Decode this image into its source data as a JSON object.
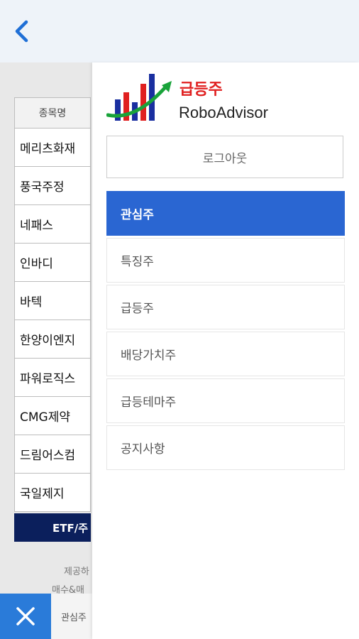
{
  "header": {
    "back_icon": "chevron-left-icon"
  },
  "background": {
    "table_header": "종목명",
    "stocks": [
      "메리츠화재",
      "풍국주정",
      "네패스",
      "인바디",
      "바텍",
      "한양이엔지",
      "파워로직스",
      "CMG제약",
      "드림어스컴",
      "국일제지"
    ],
    "etf_tab": "ETF/주",
    "note_line1": "제공하",
    "note_line2": "매수&매",
    "bottom_tab": "관심주"
  },
  "drawer": {
    "logo_title": "급등주",
    "logo_subtitle": "RoboAdvisor",
    "logout_label": "로그아웃",
    "menu": [
      {
        "label": "관심주",
        "active": true
      },
      {
        "label": "특징주",
        "active": false
      },
      {
        "label": "급등주",
        "active": false
      },
      {
        "label": "배당가치주",
        "active": false
      },
      {
        "label": "급등테마주",
        "active": false
      },
      {
        "label": "공지사항",
        "active": false
      }
    ]
  },
  "close_icon": "close-icon",
  "colors": {
    "accent": "#2a66d2",
    "close_bg": "#2a7bd9",
    "etf_bg": "#0b1f5c",
    "logo_red": "#e02020",
    "topbar": "#eef3f9"
  }
}
